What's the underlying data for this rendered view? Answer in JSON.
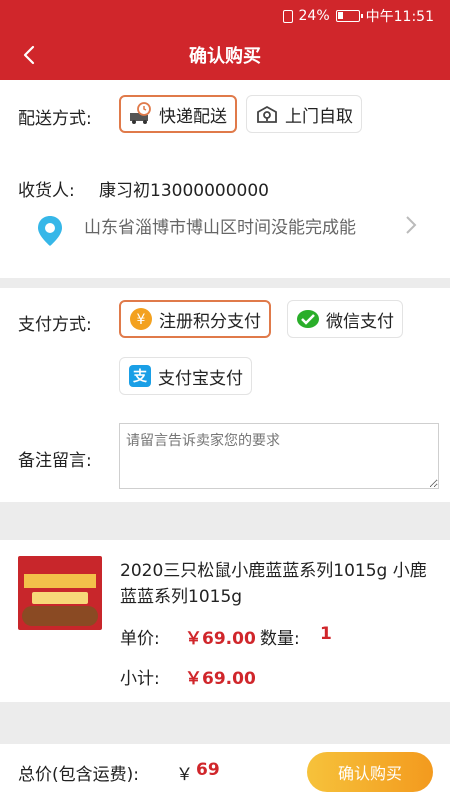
{
  "status_bar": {
    "battery": "24%",
    "time": "中午11:51"
  },
  "header": {
    "title": "确认购买"
  },
  "delivery": {
    "label": "配送方式:",
    "options": [
      {
        "label": "快递配送",
        "selected": true,
        "icon": "truck-clock-icon"
      },
      {
        "label": "上门自取",
        "selected": false,
        "icon": "pickup-pin-icon"
      }
    ]
  },
  "receiver": {
    "label": "收货人:",
    "name_phone": "康习初13000000000",
    "address": "山东省淄博市博山区时间没能完成能"
  },
  "payment": {
    "label": "支付方式:",
    "options": [
      {
        "label": "注册积分支付",
        "selected": true,
        "icon": "yen-coin-icon"
      },
      {
        "label": "微信支付",
        "selected": false,
        "icon": "wechat-icon"
      },
      {
        "label": "支付宝支付",
        "selected": false,
        "icon": "alipay-icon"
      }
    ]
  },
  "remark": {
    "label": "备注留言:",
    "placeholder": "请留言告诉卖家您的要求"
  },
  "product": {
    "name": "2020三只松鼠小鹿蓝蓝系列1015g 小鹿蓝蓝系列1015g",
    "unit_price_label": "单价:",
    "unit_price": "￥69.00",
    "quantity_label": "数量:",
    "quantity": "1",
    "subtotal_label": "小计:",
    "subtotal": "￥69.00"
  },
  "footer": {
    "total_label": "总价(包含运费):",
    "currency": "￥",
    "total": "69",
    "confirm_label": "确认购买"
  },
  "colors": {
    "brand_red": "#d0262b",
    "selected_border": "#e07a4a",
    "button_orange": "#f39a1e"
  }
}
